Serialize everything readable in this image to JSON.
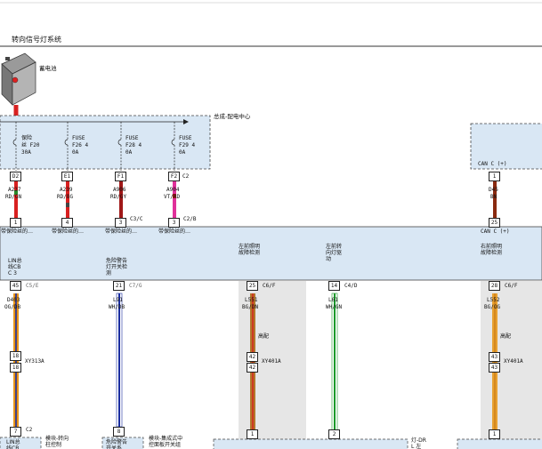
{
  "title": "转向信号灯系统",
  "battery": {
    "label": "蓄电池"
  },
  "pdc": {
    "label": "总成-配电中心",
    "fuses": [
      {
        "name": "保险\n丝 F20\n30A",
        "pin": "D2",
        "wire": "A237",
        "color": "RD/GN",
        "conn": "1"
      },
      {
        "name": "FUSE\nF26 4\n0A",
        "pin": "E1",
        "wire": "A239",
        "color": "RD/BG",
        "conn": "4"
      },
      {
        "name": "FUSE\nF28 4\n0A",
        "pin": "F1",
        "wire": "A906",
        "color": "RD/GY",
        "conn": "3"
      },
      {
        "name": "FUSE\nF29 4\n0A",
        "pin": "F2",
        "wire": "A904",
        "color": "VT/RD",
        "conn": "3"
      }
    ],
    "pin_conn_c2": "C2",
    "conn_c3c": "C3/C",
    "conn_c2b": "C2/B"
  },
  "can_module": {
    "label": "CAN C (+)",
    "pin": "1",
    "wire": "D45",
    "color": "BN",
    "conn": "25"
  },
  "bcm": {
    "fuse_labels": [
      "带保险丝的…",
      "带保险丝的…",
      "带保险丝的…",
      "带保险丝的…"
    ],
    "inputs": [
      {
        "label": "LIN总\n线CB\nC 3",
        "pin": "45",
        "conn": "C5/E",
        "wire": "D403",
        "color": "OG/DB"
      },
      {
        "label": "危险警告\n灯开关检\n测",
        "pin": "21",
        "conn": "C7/G",
        "wire": "L91",
        "color": "WH/DB"
      },
      {
        "label": "左前照明\n故障检测",
        "pin": "25",
        "conn": "C6/F",
        "wire": "L551",
        "color": "BG/DN"
      },
      {
        "label": "左前转\n向灯驱\n动",
        "pin": "14",
        "conn": "C4/D",
        "wire": "L61",
        "color": "WH/GN"
      },
      {
        "label": "右前照明\n故障检测",
        "pin": "28",
        "conn": "C6/F",
        "wire": "L552",
        "color": "BG/OG"
      }
    ],
    "can_label": "CAN C (+)"
  },
  "splices": {
    "left_a": {
      "p1": "18",
      "p2": "18",
      "conn": "XY313A"
    },
    "left_hi": {
      "label": "高配",
      "p1": "42",
      "p2": "42",
      "conn": "XY401A"
    },
    "right_hi": {
      "label": "高配",
      "p1": "43",
      "p2": "43",
      "conn": "XY401A"
    }
  },
  "bottom": {
    "lin": {
      "pin": "7",
      "conn": "C2",
      "label": "LIN总\n线CB"
    },
    "hazard": {
      "pin": "8",
      "label": "危险警告\n开关系"
    },
    "hazard_desc": "模块-转向\n柱控制",
    "hazard_desc2": "模块-集成式中\n控面板开关组",
    "lamp_left": {
      "pin": "1"
    },
    "lamp_mid": {
      "pin": "2"
    },
    "lamp_right": {
      "pin": "1"
    },
    "lamp_label": "灯-DR\nL 左"
  },
  "colors": {
    "module_fill": "#d9e7f4",
    "harness_fill": "#e6e6e6",
    "red": "#d82020",
    "orange": "#e89418",
    "blue": "#1a2ea0",
    "green": "#1a9a2a",
    "pink": "#e0309a",
    "brown": "#8a2a10"
  }
}
